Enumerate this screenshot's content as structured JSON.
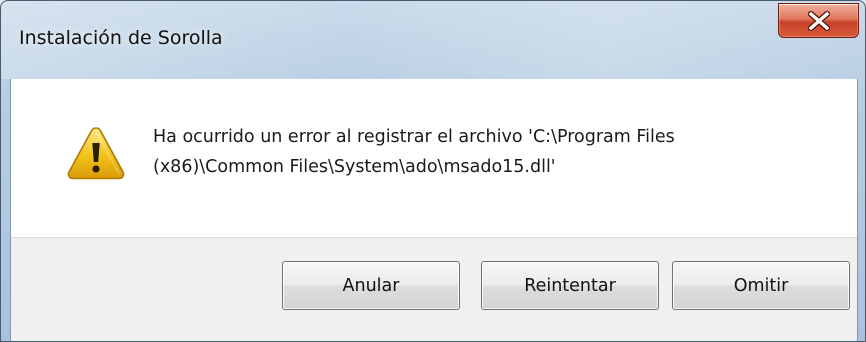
{
  "window": {
    "title": "Instalación de Sorolla"
  },
  "dialog": {
    "icon": "warning-icon",
    "message_line1": "Ha ocurrido un error al registrar el archivo 'C:\\Program Files",
    "message_line2": "(x86)\\Common Files\\System\\ado\\msado15.dll'"
  },
  "buttons": {
    "abort_label": "Anular",
    "retry_label": "Reintentar",
    "ignore_label": "Omitir"
  },
  "colors": {
    "titlebar": "#b7cde2",
    "close_button": "#c8442a",
    "warning_yellow": "#f2c318",
    "footer": "#f0f0f0"
  }
}
